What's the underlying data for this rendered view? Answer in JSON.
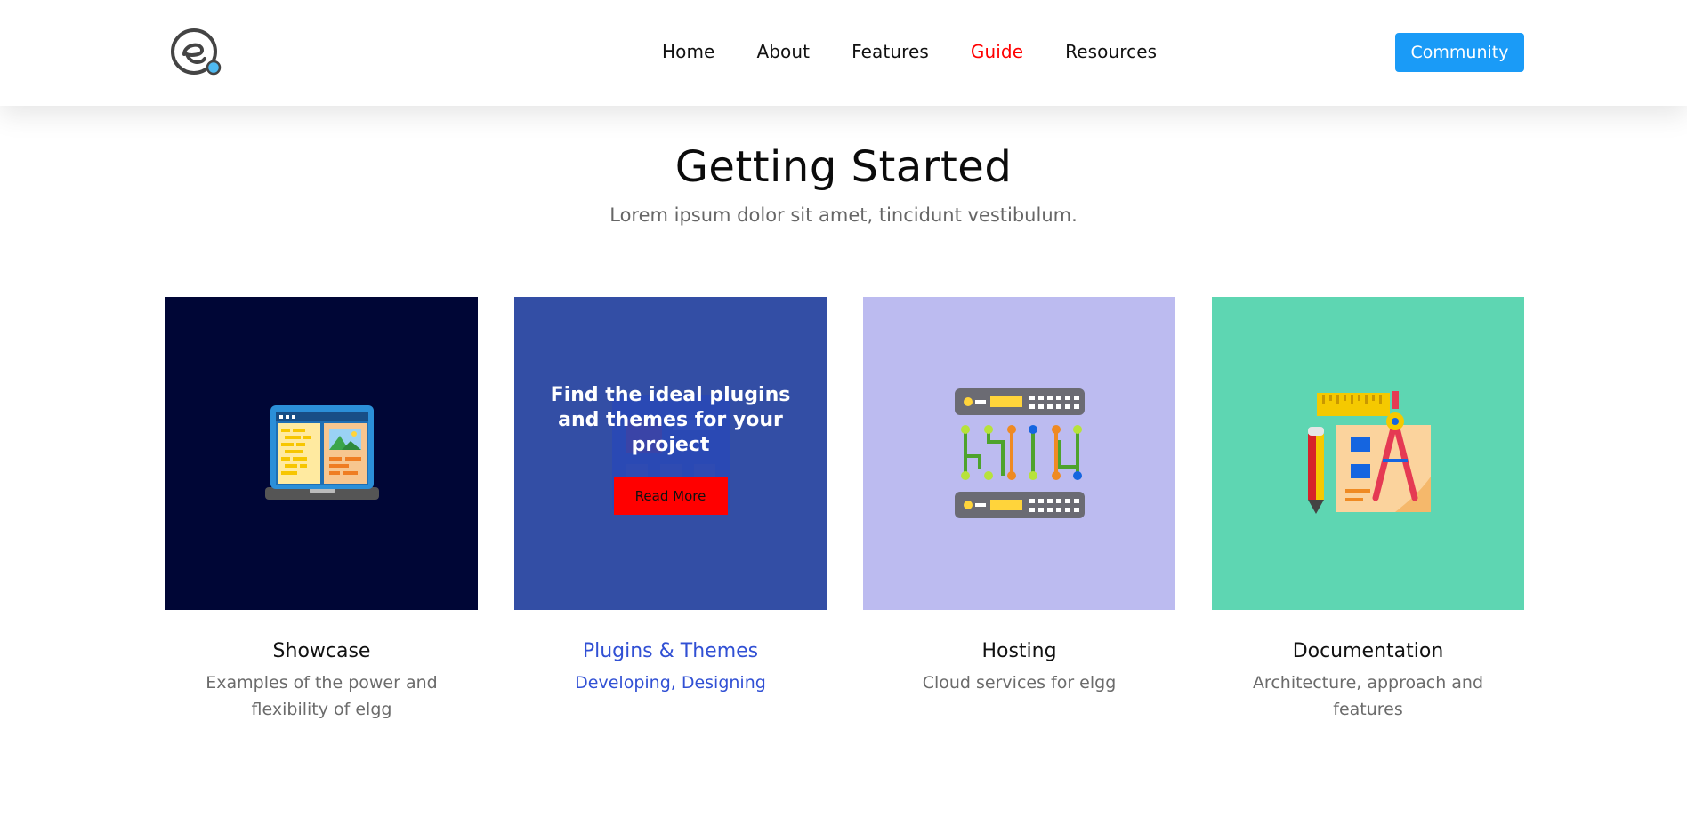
{
  "header": {
    "nav": [
      {
        "label": "Home",
        "active": false
      },
      {
        "label": "About",
        "active": false
      },
      {
        "label": "Features",
        "active": false
      },
      {
        "label": "Guide",
        "active": true
      },
      {
        "label": "Resources",
        "active": false
      }
    ],
    "community_label": "Community"
  },
  "hero": {
    "title": "Getting Started",
    "subtitle": "Lorem ipsum dolor sit amet, tincidunt vestibulum."
  },
  "cards": [
    {
      "name": "Showcase",
      "description": "Examples of the power and flexibility of elgg",
      "bg": "#000636",
      "icon": "laptop-icon"
    },
    {
      "name": "Plugins & Themes",
      "description": "Developing, Designing",
      "bg": "#334fa5",
      "icon": "plugins-icon",
      "overlay_text": "Find the ideal plugins and themes for your project",
      "button_label": "Read More"
    },
    {
      "name": "Hosting",
      "description": "Cloud services for elgg",
      "bg": "#bcbbf0",
      "icon": "server-icon"
    },
    {
      "name": "Documentation",
      "description": "Architecture, approach and features",
      "bg": "#5ed6b2",
      "icon": "drafting-tools-icon"
    }
  ],
  "colors": {
    "accent_active": "#ff0000",
    "community_button": "#1a9bf7",
    "hover_text": "#3150d4"
  }
}
